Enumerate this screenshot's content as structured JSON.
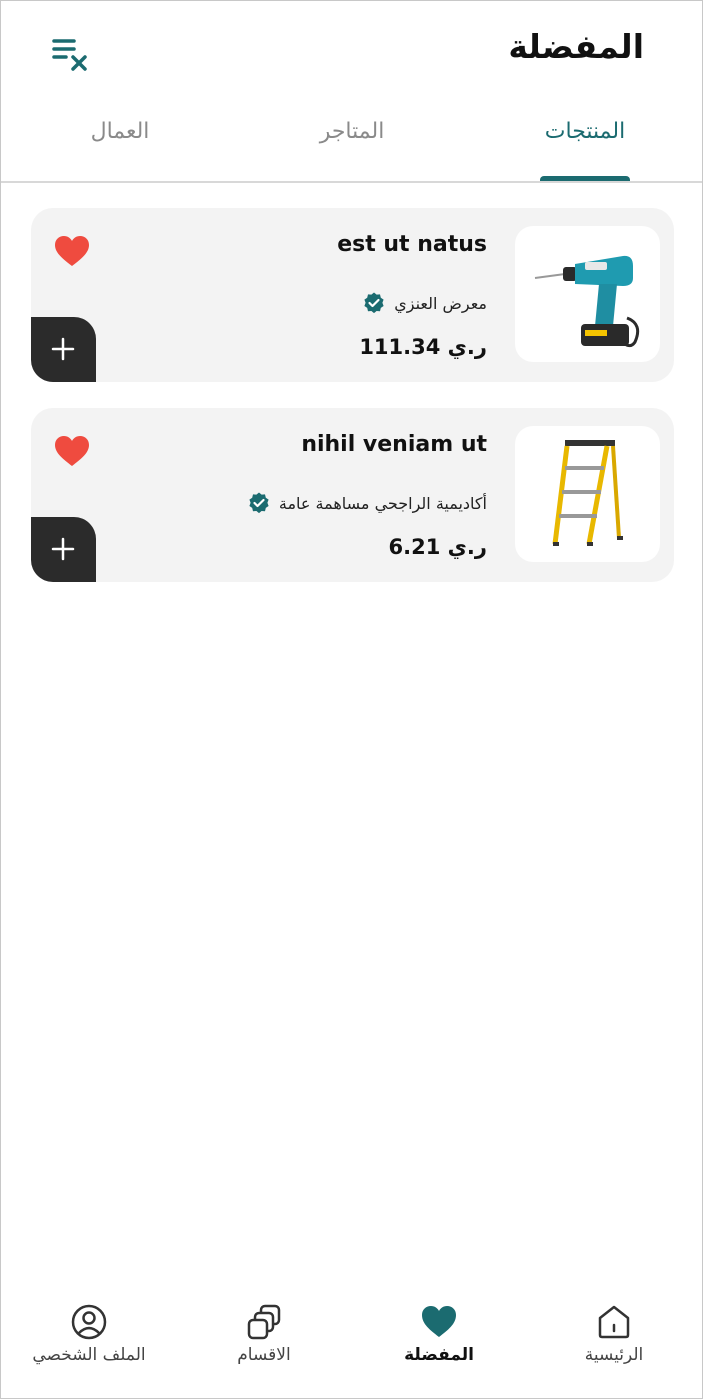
{
  "header": {
    "title": "المفضلة",
    "clear_icon": "clear-list-icon"
  },
  "tabs": [
    {
      "label": "المنتجات",
      "active": true
    },
    {
      "label": "المتاجر",
      "active": false
    },
    {
      "label": "العمال",
      "active": false
    }
  ],
  "products": [
    {
      "name": "est ut natus",
      "store": "معرض العنزي",
      "price": "111.34 ر.ي",
      "image": "drill",
      "favorite": true
    },
    {
      "name": "nihil veniam ut",
      "store": "أكاديمية الراجحي مساهمة عامة",
      "price": "6.21 ر.ي",
      "image": "ladder",
      "favorite": true
    }
  ],
  "bottom_nav": [
    {
      "label": "الرئيسية",
      "icon": "home-icon",
      "active": false
    },
    {
      "label": "المفضلة",
      "icon": "heart-icon",
      "active": true
    },
    {
      "label": "الاقسام",
      "icon": "categories-icon",
      "active": false
    },
    {
      "label": "الملف الشخصي",
      "icon": "profile-icon",
      "active": false
    }
  ],
  "colors": {
    "accent": "#1b6b70",
    "heart": "#ef4b3f",
    "card_bg": "#f3f3f3",
    "add_button": "#2b2b2b"
  }
}
